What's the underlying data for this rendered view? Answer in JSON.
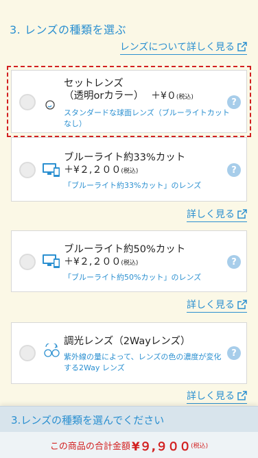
{
  "section": {
    "title": "3. レンズの種類を選ぶ",
    "about_link": "レンズについて詳しく見る"
  },
  "cards": [
    {
      "title_line1": "セットレンズ",
      "title_line2": "（透明orカラー）",
      "price": "＋¥０",
      "tax": "(税込)",
      "desc_line1": "スタンダードな球面レンズ（ブルーライトカット",
      "desc_line2": "なし）",
      "icon": "lens-icon"
    },
    {
      "title_line1": "ブルーライト約33%カット",
      "price": "＋¥２,２００",
      "tax": "(税込)",
      "desc_line1": "「ブルーライト約33%カット」のレンズ",
      "icon": "devices-icon",
      "detail_link": "詳しく見る"
    },
    {
      "title_line1": "ブルーライト約50%カット",
      "price": "＋¥２,２００",
      "tax": "(税込)",
      "desc_line1": "「ブルーライト約50%カット」のレンズ",
      "icon": "devices-icon",
      "detail_link": "詳しく見る"
    },
    {
      "title_line1": "調光レンズ（2Wayレンズ）",
      "desc_line1": "紫外線の量によって、レンズの色の濃度が変化",
      "desc_line2": "する2Way レンズ",
      "icon": "photochromic-icon",
      "detail_link": "詳しく見る"
    }
  ],
  "help_label": "?",
  "bottom": {
    "prompt": "3.レンズの種類を選んでください",
    "total_label": "この商品の合計金額",
    "total_value": "¥９,９００",
    "total_tax": "(税込)"
  },
  "colors": {
    "accent": "#2a8fd0",
    "alert": "#d22020",
    "background": "#fbf8e6"
  }
}
